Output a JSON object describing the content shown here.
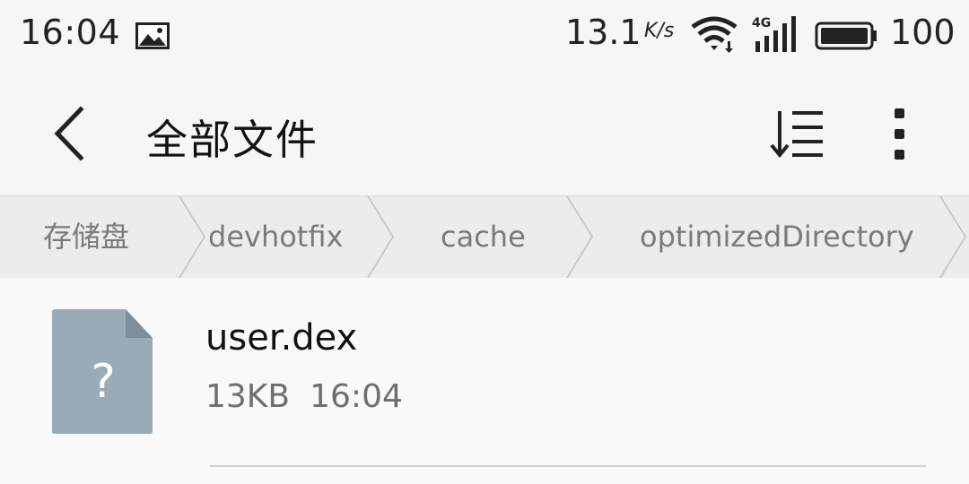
{
  "status_bar": {
    "time": "16:04",
    "notification_icon": "gallery-icon",
    "net_speed": "13.1",
    "net_speed_unit": "K/s",
    "wifi_icon": "wifi-icon",
    "network_type": "4G",
    "battery_level": "100"
  },
  "app_bar": {
    "back_icon": "back-arrow-icon",
    "title": "全部文件",
    "sort_icon": "sort-icon",
    "more_icon": "more-vertical-icon"
  },
  "breadcrumb": {
    "items": [
      "存储盘",
      "devhotfix",
      "cache",
      "optimizedDirectory"
    ]
  },
  "files": [
    {
      "name": "user.dex",
      "size": "13KB",
      "modified": "16:04",
      "icon": "unknown-file-icon",
      "icon_glyph": "?"
    }
  ],
  "colors": {
    "background": "#f6f6f6",
    "breadcrumb_bg": "#ececec",
    "file_icon": "#9aabb8",
    "file_icon_fold": "#7f8e9a"
  }
}
